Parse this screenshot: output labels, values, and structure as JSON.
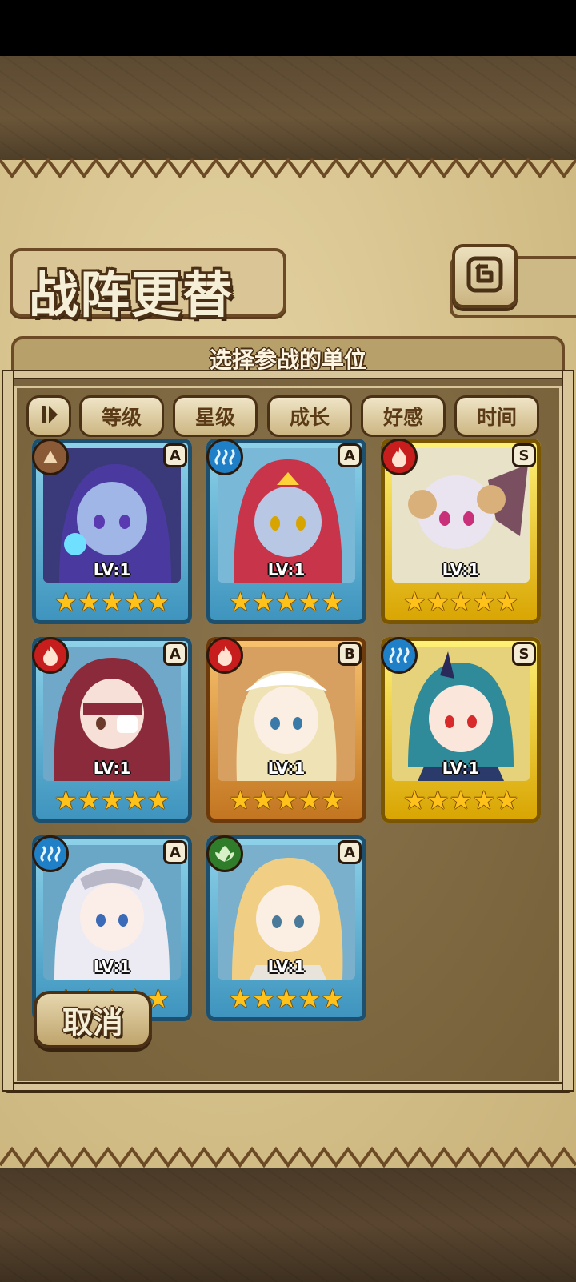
{
  "screen": {
    "title": "战阵更替",
    "subtitle": "选择参战的单位"
  },
  "sort_bar": {
    "toggle_icon": "sort-toggle-icon",
    "buttons": [
      "等级",
      "星级",
      "成长",
      "好感",
      "时间"
    ]
  },
  "cards": [
    {
      "element": "earth",
      "rank": "A",
      "level": "LV:1",
      "stars": 5,
      "frame": "blue"
    },
    {
      "element": "water",
      "rank": "A",
      "level": "LV:1",
      "stars": 5,
      "frame": "blue"
    },
    {
      "element": "fire",
      "rank": "S",
      "level": "LV:1",
      "stars": 5,
      "frame": "gold"
    },
    {
      "element": "fire",
      "rank": "A",
      "level": "LV:1",
      "stars": 5,
      "frame": "blue"
    },
    {
      "element": "fire",
      "rank": "B",
      "level": "LV:1",
      "stars": 5,
      "frame": "bronze"
    },
    {
      "element": "water",
      "rank": "S",
      "level": "LV:1",
      "stars": 5,
      "frame": "gold"
    },
    {
      "element": "water",
      "rank": "A",
      "level": "LV:1",
      "stars": 5,
      "frame": "blue"
    },
    {
      "element": "wood",
      "rank": "A",
      "level": "LV:1",
      "stars": 5,
      "frame": "blue"
    }
  ],
  "cancel_label": "取消",
  "colors": {
    "earth": "#8a5a36",
    "water": "#1f7fc7",
    "fire": "#c81d1d",
    "wood": "#2f7d2a"
  }
}
